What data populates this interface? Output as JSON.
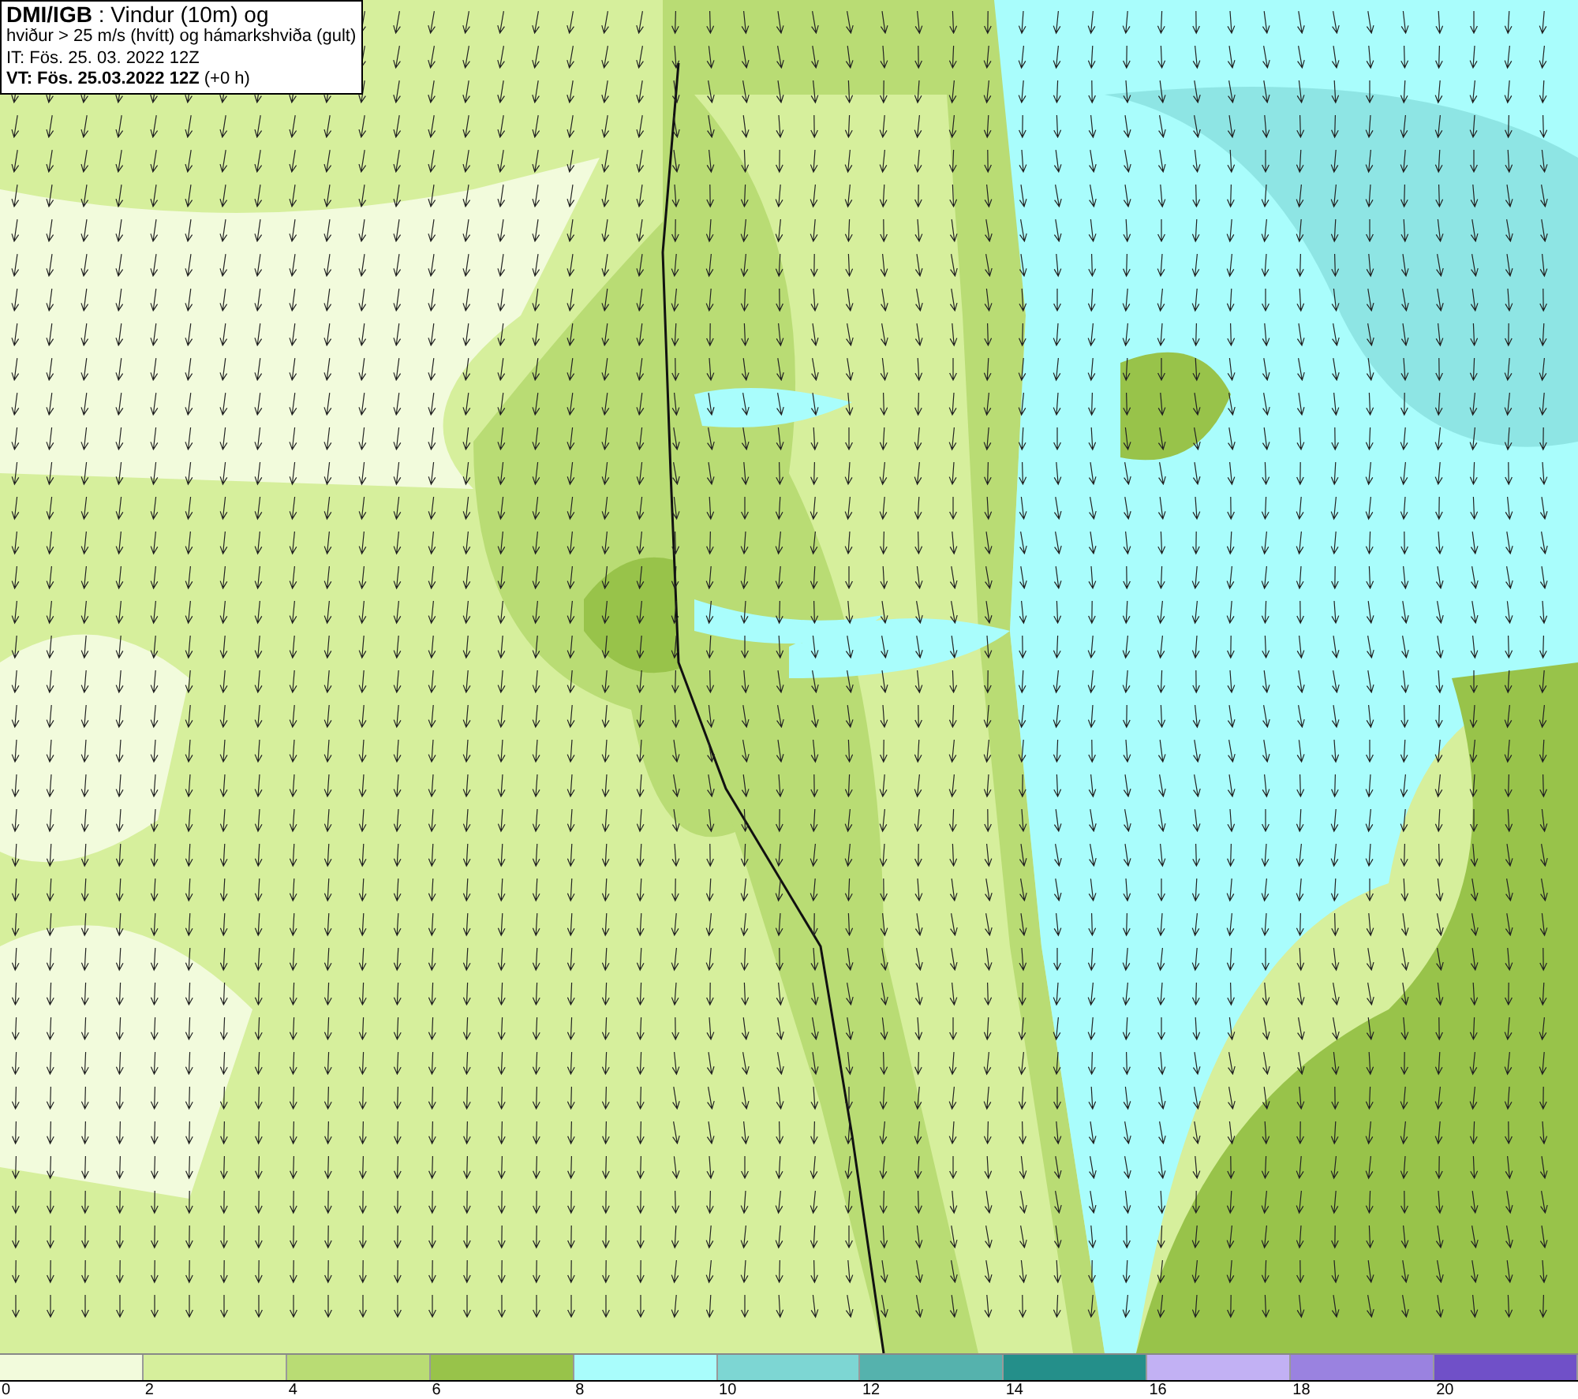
{
  "caption": {
    "lines": [
      "**DMI/IGB** : Vindur (10m) og",
      "hviður > 25 m/s (hvítt) og hámarkshviða (gult)",
      "IT: Fös. 25. 03. 2022 12Z",
      "**VT: Fös. 25.03.2022 12Z** (+0 h)"
    ]
  },
  "legend": {
    "bins": [
      {
        "color": "#f2fbdc"
      },
      {
        "color": "#d6ef9c"
      },
      {
        "color": "#b9dc74"
      },
      {
        "color": "#98c34a"
      },
      {
        "color": "#a9fdfc"
      },
      {
        "color": "#7dd6d3"
      },
      {
        "color": "#55b2ad"
      },
      {
        "color": "#248f8a"
      },
      {
        "color": "#c2b1f4"
      },
      {
        "color": "#9a82e0"
      },
      {
        "color": "#7050c8"
      }
    ],
    "ticks": [
      "0",
      "2",
      "4",
      "6",
      "8",
      "10",
      "12",
      "14",
      "16",
      "18",
      "20"
    ]
  }
}
